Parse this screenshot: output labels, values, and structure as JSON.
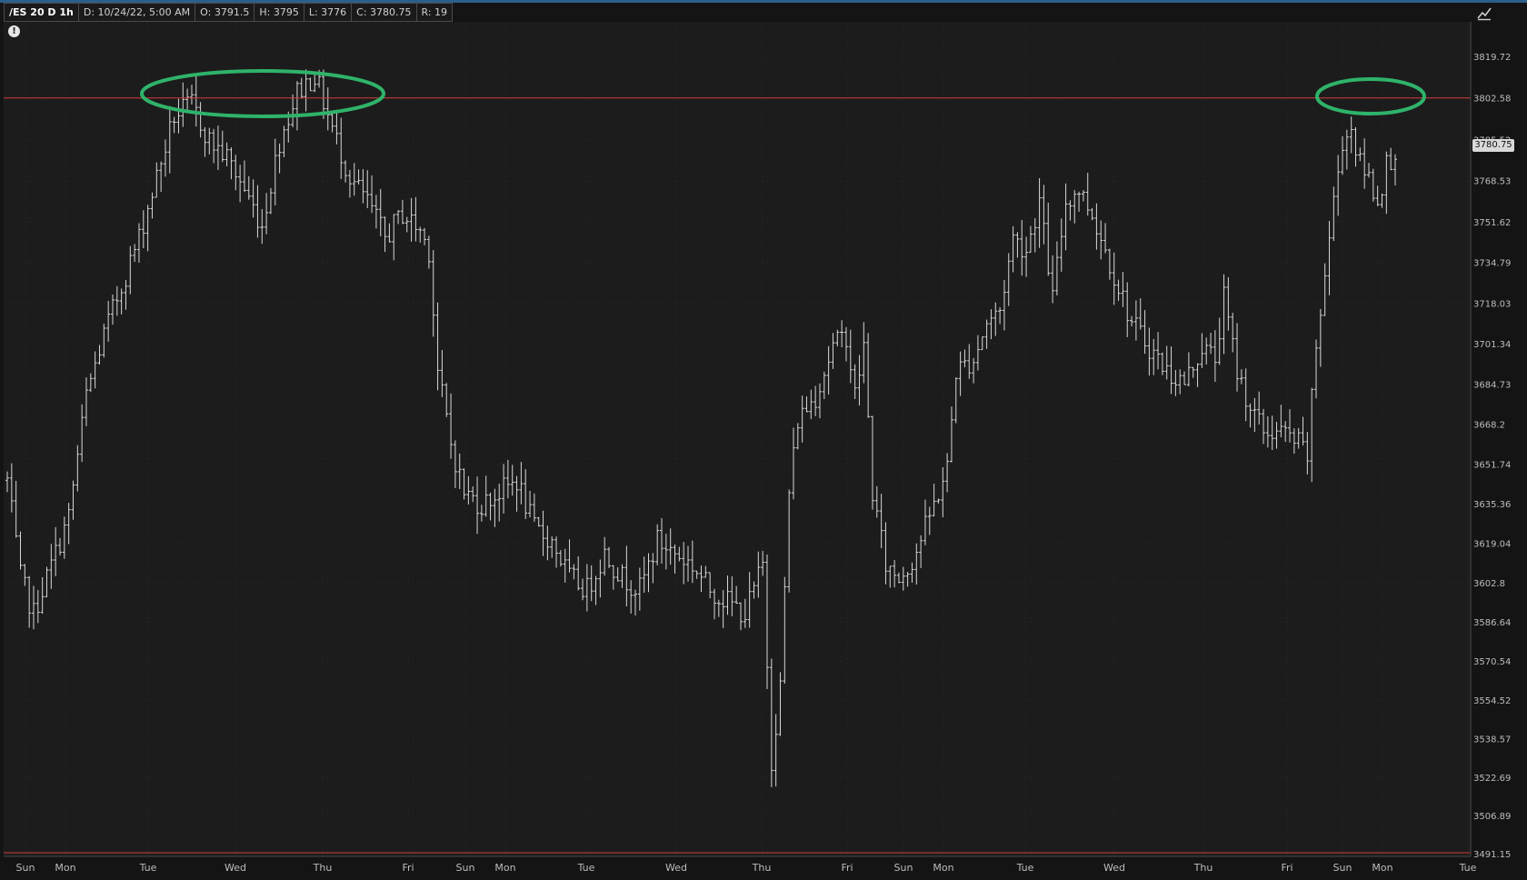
{
  "header": {
    "symbol": "/ES 20 D 1h",
    "date": "D: 10/24/22, 5:00 AM",
    "open": "O: 3791.5",
    "high": "H: 3795",
    "low": "L: 3776",
    "close": "C: 3780.75",
    "range": "R: 19"
  },
  "alert_icon": "exclamation-circle-icon",
  "corner_icon": "expand-chart-icon",
  "current_price_label": "3780.75",
  "colors": {
    "background": "#1c1c1c",
    "bars": "#d8d8d8",
    "resistance_line": "#d23c3c",
    "highlight_ellipse": "#2fb36a"
  },
  "chart_data": {
    "type": "ohlc",
    "timeframe": "1h",
    "y_ticks": [
      3819.72,
      3802.58,
      3785.52,
      3768.53,
      3751.62,
      3734.79,
      3718.03,
      3701.34,
      3684.73,
      3668.2,
      3651.74,
      3635.36,
      3619.04,
      3602.8,
      3586.64,
      3570.54,
      3554.52,
      3538.57,
      3522.69,
      3506.89,
      3491.15
    ],
    "y_tick_labels": [
      "3819.72",
      "3802.58",
      "3785.52",
      "3768.53",
      "3751.62",
      "3734.79",
      "3718.03",
      "3701.34",
      "3684.73",
      "3668.2",
      "3651.74",
      "3635.36",
      "3619.04",
      "3602.8",
      "3586.64",
      "3570.54",
      "3554.52",
      "3538.57",
      "3522.69",
      "3506.89",
      "3491.15"
    ],
    "x_labels": [
      "Sun",
      "Mon",
      "Tue",
      "Wed",
      "Thu",
      "Fri",
      "Sun",
      "Mon",
      "Tue",
      "Wed",
      "Thu",
      "Fri",
      "Sun",
      "Mon",
      "Tue",
      "Wed",
      "Thu",
      "Fri",
      "Sun",
      "Mon",
      "Tue"
    ],
    "resistance_level": 3802.58,
    "bottom_line_level": 3491.15,
    "current_price": 3780.75,
    "anchors": [
      [
        0,
        3645
      ],
      [
        3,
        3605
      ],
      [
        6,
        3590
      ],
      [
        10,
        3610
      ],
      [
        14,
        3630
      ],
      [
        18,
        3680
      ],
      [
        22,
        3705
      ],
      [
        26,
        3725
      ],
      [
        30,
        3745
      ],
      [
        34,
        3770
      ],
      [
        38,
        3795
      ],
      [
        42,
        3800
      ],
      [
        46,
        3785
      ],
      [
        50,
        3778
      ],
      [
        54,
        3765
      ],
      [
        58,
        3750
      ],
      [
        62,
        3785
      ],
      [
        66,
        3805
      ],
      [
        70,
        3812
      ],
      [
        74,
        3790
      ],
      [
        78,
        3770
      ],
      [
        82,
        3760
      ],
      [
        86,
        3745
      ],
      [
        90,
        3755
      ],
      [
        94,
        3748
      ],
      [
        96,
        3740
      ],
      [
        98,
        3690
      ],
      [
        101,
        3660
      ],
      [
        104,
        3640
      ],
      [
        108,
        3635
      ],
      [
        112,
        3640
      ],
      [
        116,
        3645
      ],
      [
        120,
        3625
      ],
      [
        124,
        3620
      ],
      [
        128,
        3605
      ],
      [
        132,
        3600
      ],
      [
        136,
        3615
      ],
      [
        140,
        3605
      ],
      [
        144,
        3600
      ],
      [
        148,
        3620
      ],
      [
        152,
        3615
      ],
      [
        156,
        3610
      ],
      [
        160,
        3600
      ],
      [
        164,
        3595
      ],
      [
        168,
        3590
      ],
      [
        170,
        3600
      ],
      [
        172,
        3610
      ],
      [
        174,
        3530
      ],
      [
        176,
        3560
      ],
      [
        178,
        3640
      ],
      [
        180,
        3670
      ],
      [
        184,
        3680
      ],
      [
        188,
        3700
      ],
      [
        191,
        3705
      ],
      [
        193,
        3680
      ],
      [
        195,
        3700
      ],
      [
        197,
        3640
      ],
      [
        200,
        3610
      ],
      [
        203,
        3605
      ],
      [
        206,
        3612
      ],
      [
        210,
        3630
      ],
      [
        214,
        3650
      ],
      [
        216,
        3690
      ],
      [
        220,
        3695
      ],
      [
        223,
        3710
      ],
      [
        226,
        3715
      ],
      [
        229,
        3745
      ],
      [
        232,
        3740
      ],
      [
        235,
        3760
      ],
      [
        238,
        3720
      ],
      [
        241,
        3760
      ],
      [
        244,
        3765
      ],
      [
        247,
        3755
      ],
      [
        250,
        3740
      ],
      [
        253,
        3725
      ],
      [
        256,
        3710
      ],
      [
        260,
        3700
      ],
      [
        264,
        3690
      ],
      [
        268,
        3685
      ],
      [
        272,
        3700
      ],
      [
        275,
        3695
      ],
      [
        277,
        3720
      ],
      [
        280,
        3690
      ],
      [
        283,
        3675
      ],
      [
        286,
        3665
      ],
      [
        290,
        3665
      ],
      [
        294,
        3660
      ],
      [
        296,
        3655
      ],
      [
        298,
        3700
      ],
      [
        300,
        3730
      ],
      [
        302,
        3760
      ],
      [
        304,
        3785
      ],
      [
        306,
        3790
      ],
      [
        308,
        3775
      ],
      [
        310,
        3770
      ],
      [
        312,
        3760
      ],
      [
        314,
        3775
      ],
      [
        316,
        3781
      ]
    ]
  }
}
